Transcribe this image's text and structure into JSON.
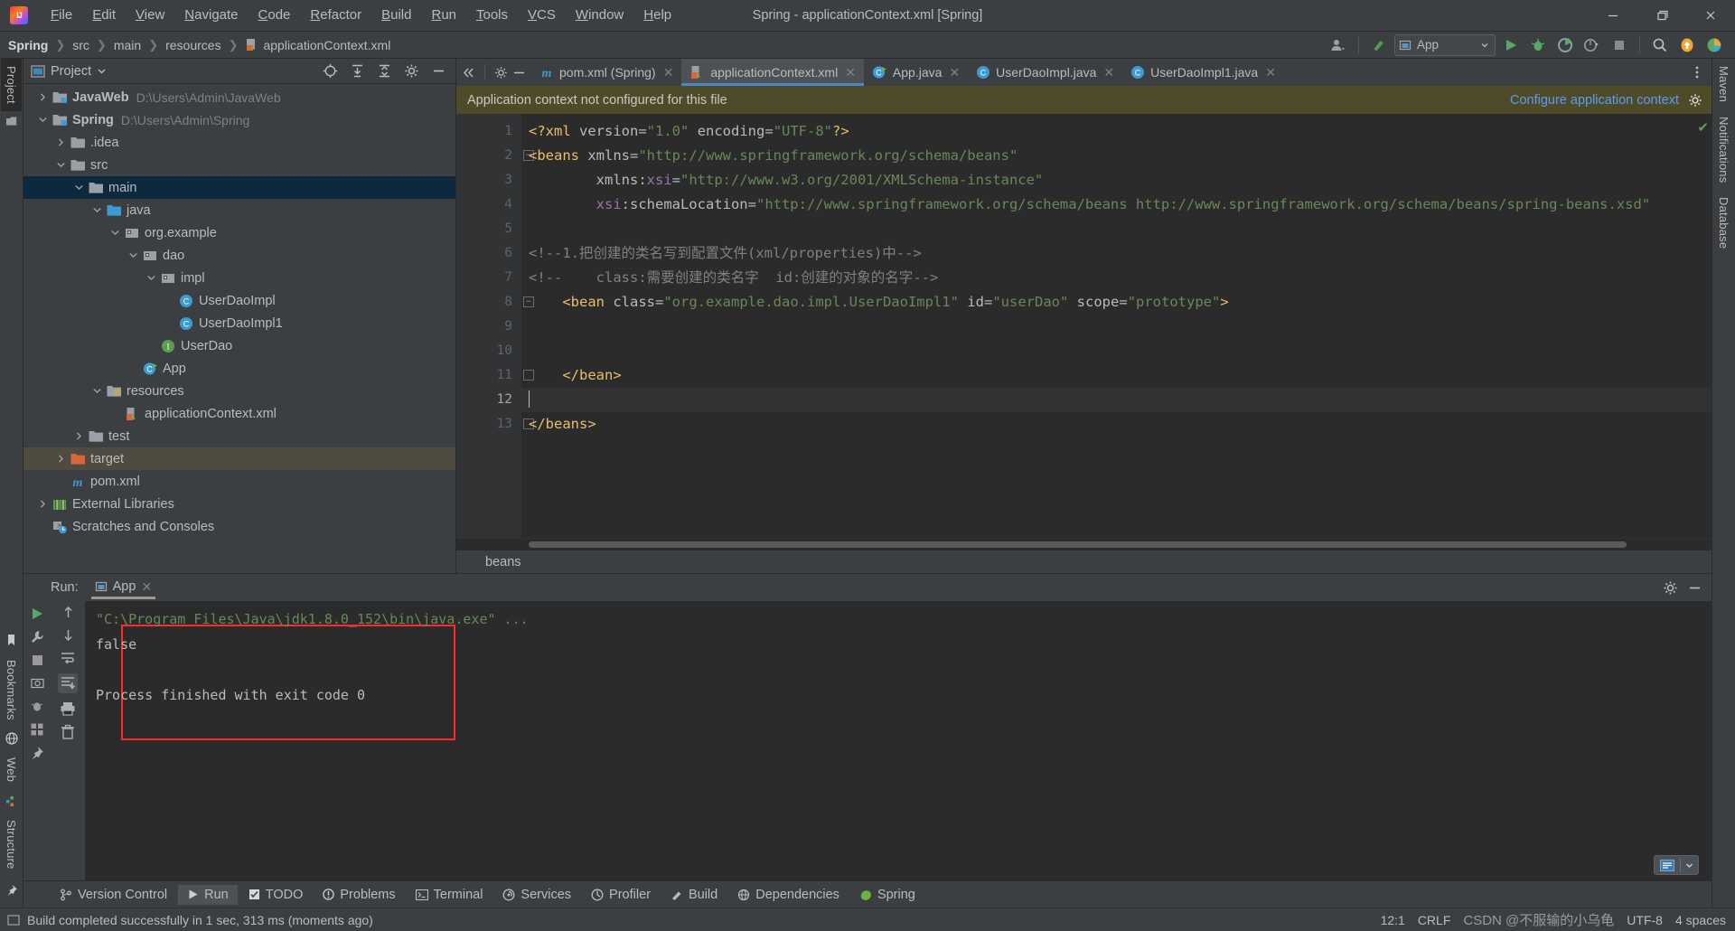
{
  "window": {
    "title": "Spring - applicationContext.xml [Spring]",
    "minimize": "—",
    "maximize": "❐",
    "close": "✕"
  },
  "menu": [
    "File",
    "Edit",
    "View",
    "Navigate",
    "Code",
    "Refactor",
    "Build",
    "Run",
    "Tools",
    "VCS",
    "Window",
    "Help"
  ],
  "breadcrumb": {
    "items": [
      "Spring",
      "src",
      "main",
      "resources",
      "applicationContext.xml"
    ],
    "separator": "❯"
  },
  "toolbar": {
    "run_config": "App",
    "run_tooltip": "Run",
    "debug_tooltip": "Debug",
    "coverage_tooltip": "Run with Coverage",
    "profile_tooltip": "Profiler",
    "stop_tooltip": "Stop",
    "search_tooltip": "Search Everywhere",
    "updates_tooltip": "Updates"
  },
  "left_strip": {
    "tabs": [
      "Project"
    ],
    "bottom_tabs": [
      "Structure",
      "Bookmarks",
      "Web"
    ]
  },
  "right_strip": {
    "tabs": [
      "Maven",
      "Notifications",
      "Database"
    ]
  },
  "project_panel": {
    "title": "Project",
    "tree": [
      {
        "indent": 0,
        "arrow": "right",
        "icon": "module-folder",
        "label": "JavaWeb",
        "bold": true,
        "path": "D:\\Users\\Admin\\JavaWeb",
        "state": "none"
      },
      {
        "indent": 0,
        "arrow": "down",
        "icon": "module-folder",
        "label": "Spring",
        "bold": true,
        "path": "D:\\Users\\Admin\\Spring",
        "state": "none"
      },
      {
        "indent": 1,
        "arrow": "right",
        "icon": "folder",
        "label": ".idea",
        "bold": false,
        "path": "",
        "state": "none"
      },
      {
        "indent": 1,
        "arrow": "down",
        "icon": "folder",
        "label": "src",
        "bold": false,
        "path": "",
        "state": "none"
      },
      {
        "indent": 2,
        "arrow": "down",
        "icon": "folder",
        "label": "main",
        "bold": false,
        "path": "",
        "state": "selected"
      },
      {
        "indent": 3,
        "arrow": "down",
        "icon": "folder-source",
        "label": "java",
        "bold": false,
        "path": "",
        "state": "none"
      },
      {
        "indent": 4,
        "arrow": "down",
        "icon": "package",
        "label": "org.example",
        "bold": false,
        "path": "",
        "state": "none"
      },
      {
        "indent": 5,
        "arrow": "down",
        "icon": "package",
        "label": "dao",
        "bold": false,
        "path": "",
        "state": "none"
      },
      {
        "indent": 6,
        "arrow": "down",
        "icon": "package",
        "label": "impl",
        "bold": false,
        "path": "",
        "state": "none"
      },
      {
        "indent": 7,
        "arrow": "none",
        "icon": "class",
        "label": "UserDaoImpl",
        "bold": false,
        "path": "",
        "state": "none"
      },
      {
        "indent": 7,
        "arrow": "none",
        "icon": "class",
        "label": "UserDaoImpl1",
        "bold": false,
        "path": "",
        "state": "none"
      },
      {
        "indent": 6,
        "arrow": "none",
        "icon": "interface",
        "label": "UserDao",
        "bold": false,
        "path": "",
        "state": "none"
      },
      {
        "indent": 5,
        "arrow": "none",
        "icon": "runnable-class",
        "label": "App",
        "bold": false,
        "path": "",
        "state": "none"
      },
      {
        "indent": 3,
        "arrow": "down",
        "icon": "folder-resources",
        "label": "resources",
        "bold": false,
        "path": "",
        "state": "none"
      },
      {
        "indent": 4,
        "arrow": "none",
        "icon": "spring-xml",
        "label": "applicationContext.xml",
        "bold": false,
        "path": "",
        "state": "none"
      },
      {
        "indent": 2,
        "arrow": "right",
        "icon": "folder",
        "label": "test",
        "bold": false,
        "path": "",
        "state": "none"
      },
      {
        "indent": 1,
        "arrow": "right",
        "icon": "folder-target",
        "label": "target",
        "bold": false,
        "path": "",
        "state": "target"
      },
      {
        "indent": 1,
        "arrow": "none",
        "icon": "maven",
        "label": "pom.xml",
        "bold": false,
        "path": "",
        "state": "none"
      },
      {
        "indent": 0,
        "arrow": "right",
        "icon": "libraries",
        "label": "External Libraries",
        "bold": false,
        "path": "",
        "state": "none"
      },
      {
        "indent": 0,
        "arrow": "none",
        "icon": "scratches",
        "label": "Scratches and Consoles",
        "bold": false,
        "path": "",
        "state": "none"
      }
    ]
  },
  "editor": {
    "tabs": [
      {
        "label": "pom.xml (Spring)",
        "icon": "maven",
        "active": false
      },
      {
        "label": "applicationContext.xml",
        "icon": "spring-xml",
        "active": true
      },
      {
        "label": "App.java",
        "icon": "runnable-class",
        "active": false
      },
      {
        "label": "UserDaoImpl.java",
        "icon": "class",
        "active": false
      },
      {
        "label": "UserDaoImpl1.java",
        "icon": "class",
        "active": false
      }
    ],
    "notification": {
      "message": "Application context not configured for this file",
      "action": "Configure application context"
    },
    "line_numbers": [
      "1",
      "2",
      "3",
      "4",
      "5",
      "6",
      "7",
      "8",
      "9",
      "10",
      "11",
      "12",
      "13"
    ],
    "caret_line": 12,
    "bottom_breadcrumb": "beans",
    "status_ok": "✔",
    "lines": [
      {
        "n": 1,
        "segments": [
          {
            "t": "<?xml ",
            "c": "tag"
          },
          {
            "t": "version",
            "c": "attr"
          },
          {
            "t": "=",
            "c": "eq"
          },
          {
            "t": "\"1.0\"",
            "c": "attrv"
          },
          {
            "t": " ",
            "c": "eq"
          },
          {
            "t": "encoding",
            "c": "attr"
          },
          {
            "t": "=",
            "c": "eq"
          },
          {
            "t": "\"UTF-8\"",
            "c": "attrv"
          },
          {
            "t": "?>",
            "c": "tag"
          }
        ]
      },
      {
        "n": 2,
        "segments": [
          {
            "t": "<beans ",
            "c": "tag"
          },
          {
            "t": "xmlns",
            "c": "attr"
          },
          {
            "t": "=",
            "c": "eq"
          },
          {
            "t": "\"http://www.springframework.org/schema/beans\"",
            "c": "attrv"
          }
        ]
      },
      {
        "n": 3,
        "segments": [
          {
            "t": "        xmlns:",
            "c": "attr"
          },
          {
            "t": "xsi",
            "c": "ns"
          },
          {
            "t": "=",
            "c": "eq"
          },
          {
            "t": "\"http://www.w3.org/2001/XMLSchema-instance\"",
            "c": "attrv"
          }
        ]
      },
      {
        "n": 4,
        "segments": [
          {
            "t": "        ",
            "c": "eq"
          },
          {
            "t": "xsi",
            "c": "ns"
          },
          {
            "t": ":schemaLocation",
            "c": "attr"
          },
          {
            "t": "=",
            "c": "eq"
          },
          {
            "t": "\"http://www.springframework.org/schema/beans http://www.springframework.org/schema/beans/spring-beans.xsd\"",
            "c": "attrv"
          }
        ]
      },
      {
        "n": 5,
        "segments": [
          {
            "t": "",
            "c": "eq"
          }
        ]
      },
      {
        "n": 6,
        "segments": [
          {
            "t": "<!--1.把创建的类名写到配置文件(xml/properties)中-->",
            "c": "cmt"
          }
        ]
      },
      {
        "n": 7,
        "segments": [
          {
            "t": "<!--    class:需要创建的类名字  id:创建的对象的名字-->",
            "c": "cmt"
          }
        ]
      },
      {
        "n": 8,
        "segments": [
          {
            "t": "    <bean ",
            "c": "tag"
          },
          {
            "t": "class",
            "c": "attr"
          },
          {
            "t": "=",
            "c": "eq"
          },
          {
            "t": "\"org.example.dao.impl.UserDaoImpl1\"",
            "c": "attrv"
          },
          {
            "t": " ",
            "c": "eq"
          },
          {
            "t": "id",
            "c": "attr"
          },
          {
            "t": "=",
            "c": "eq"
          },
          {
            "t": "\"userDao\"",
            "c": "attrv"
          },
          {
            "t": " ",
            "c": "eq"
          },
          {
            "t": "scope",
            "c": "attr"
          },
          {
            "t": "=",
            "c": "eq"
          },
          {
            "t": "\"prototype\"",
            "c": "attrv"
          },
          {
            "t": ">",
            "c": "tag"
          }
        ]
      },
      {
        "n": 9,
        "segments": [
          {
            "t": "",
            "c": "eq"
          }
        ]
      },
      {
        "n": 10,
        "segments": [
          {
            "t": "",
            "c": "eq"
          }
        ]
      },
      {
        "n": 11,
        "segments": [
          {
            "t": "    </bean>",
            "c": "tag"
          }
        ]
      },
      {
        "n": 12,
        "segments": [
          {
            "t": "",
            "c": "eq"
          }
        ]
      },
      {
        "n": 13,
        "segments": [
          {
            "t": "</beans>",
            "c": "tag"
          }
        ]
      }
    ]
  },
  "run_panel": {
    "label": "Run:",
    "tab": "App",
    "console": [
      {
        "text": "\"C:\\Program Files\\Java\\jdk1.8.0_152\\bin\\java.exe\" ...",
        "style": "cmd"
      },
      {
        "text": "false",
        "style": "plain"
      },
      {
        "text": "",
        "style": "plain"
      },
      {
        "text": "Process finished with exit code 0",
        "style": "plain"
      }
    ],
    "highlight_color": "#ff2b2b"
  },
  "bottom_toolbar": [
    {
      "label": "Version Control",
      "icon": "branch-icon",
      "active": false
    },
    {
      "label": "Run",
      "icon": "play-icon",
      "active": true
    },
    {
      "label": "TODO",
      "icon": "todo-icon",
      "active": false
    },
    {
      "label": "Problems",
      "icon": "problems-icon",
      "active": false
    },
    {
      "label": "Terminal",
      "icon": "terminal-icon",
      "active": false
    },
    {
      "label": "Services",
      "icon": "services-icon",
      "active": false
    },
    {
      "label": "Profiler",
      "icon": "profiler-icon",
      "active": false
    },
    {
      "label": "Build",
      "icon": "build-icon",
      "active": false
    },
    {
      "label": "Dependencies",
      "icon": "dependencies-icon",
      "active": false
    },
    {
      "label": "Spring",
      "icon": "spring-icon",
      "active": false
    }
  ],
  "status_bar": {
    "message": "Build completed successfully in 1 sec, 313 ms (moments ago)",
    "caret_position": "12:1",
    "line_separator": "CRLF",
    "encoding": "UTF-8",
    "indent": "4 spaces",
    "watermark": "CSDN @不服输的小乌龟"
  },
  "colors": {
    "accent": "#4a88c7",
    "warning_bar": "#4f4b28",
    "selection": "#0d293e",
    "link": "#589df6",
    "string": "#6a8759",
    "tag": "#e8bf6a"
  }
}
